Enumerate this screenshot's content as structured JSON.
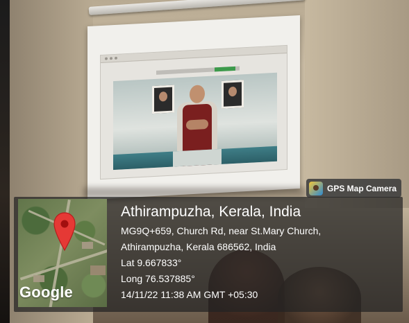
{
  "gps_overlay": {
    "badge_label": "GPS Map Camera",
    "map_brand": "Google",
    "place_title": "Athirampuzha, Kerala, India",
    "address_line_1": "MG9Q+659, Church Rd, near St.Mary Church,",
    "address_line_2": "Athirampuzha, Kerala 686562, India",
    "latitude": "Lat 9.667833°",
    "longitude": "Long 76.537885°",
    "timestamp": "14/11/22 11:38 AM GMT +05:30",
    "pin_color": "#e53935",
    "panel_color": "#232323"
  },
  "scene": {
    "icon_names": [
      "gps-map-camera-icon",
      "map-pin-icon"
    ]
  }
}
